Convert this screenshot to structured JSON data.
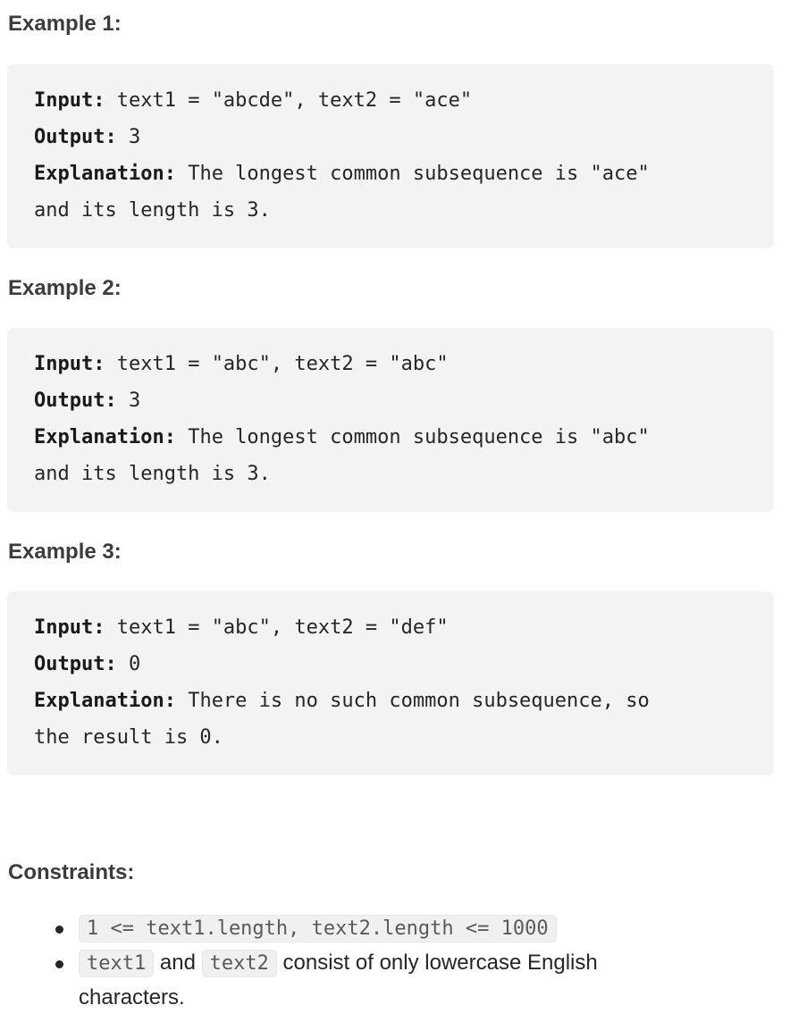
{
  "examples": [
    {
      "heading": "Example 1:",
      "input_label": "Input:",
      "input_value": " text1 = \"abcde\", text2 = \"ace\"",
      "output_label": "Output:",
      "output_value": " 3",
      "explanation_label": "Explanation:",
      "explanation_line1": " The longest common subsequence is \"ace\"",
      "explanation_line2": "and its length is 3."
    },
    {
      "heading": "Example 2:",
      "input_label": "Input:",
      "input_value": " text1 = \"abc\", text2 = \"abc\"",
      "output_label": "Output:",
      "output_value": " 3",
      "explanation_label": "Explanation:",
      "explanation_line1": " The longest common subsequence is \"abc\"",
      "explanation_line2": "and its length is 3."
    },
    {
      "heading": "Example 3:",
      "input_label": "Input:",
      "input_value": " text1 = \"abc\", text2 = \"def\"",
      "output_label": "Output:",
      "output_value": " 0",
      "explanation_label": "Explanation:",
      "explanation_line1": " There is no such common subsequence, so",
      "explanation_line2": "the result is 0."
    }
  ],
  "constraints": {
    "heading": "Constraints:",
    "item1_code": "1 <= text1.length, text2.length <= 1000",
    "item2_code_a": "text1",
    "item2_and": " and ",
    "item2_code_b": "text2",
    "item2_text": " consist of only lowercase English characters."
  }
}
